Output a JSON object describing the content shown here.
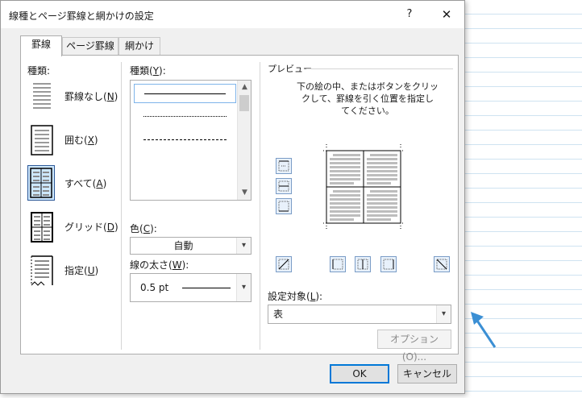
{
  "window": {
    "title": "線種とページ罫線と網かけの設定",
    "help_label": "?",
    "close_label": "✕"
  },
  "tabs": [
    {
      "label": "罫線",
      "active": true
    },
    {
      "label": "ページ罫線",
      "active": false
    },
    {
      "label": "網かけ",
      "active": false
    }
  ],
  "settings": {
    "heading": "種類:",
    "items": [
      {
        "label": "罫線なし(",
        "key": "N",
        "suffix": ")",
        "selected": false
      },
      {
        "label": "囲む(",
        "key": "X",
        "suffix": ")",
        "selected": false
      },
      {
        "label": "すべて(",
        "key": "A",
        "suffix": ")",
        "selected": true
      },
      {
        "label": "グリッド(",
        "key": "D",
        "suffix": ")",
        "selected": false
      },
      {
        "label": "指定(",
        "key": "U",
        "suffix": ")",
        "selected": false
      }
    ]
  },
  "style": {
    "label": "種類(",
    "key": "Y",
    "suffix": "):"
  },
  "color": {
    "label": "色(",
    "key": "C",
    "suffix": "):",
    "value": "自動"
  },
  "width": {
    "label": "線の太さ(",
    "key": "W",
    "suffix": "):",
    "value": "0.5 pt"
  },
  "preview": {
    "heading": "プレビュー",
    "instructions": [
      "下の絵の中、またはボタンをクリッ",
      "クして、罫線を引く位置を指定し",
      "てください。"
    ]
  },
  "apply_to": {
    "label": "設定対象(",
    "key": "L",
    "suffix": "):",
    "value": "表"
  },
  "buttons": {
    "options": "オプション(O)...",
    "ok": "OK",
    "cancel": "キャンセル"
  },
  "colors": {
    "accent": "#0078d7",
    "pointer": "#3b8fd4"
  }
}
